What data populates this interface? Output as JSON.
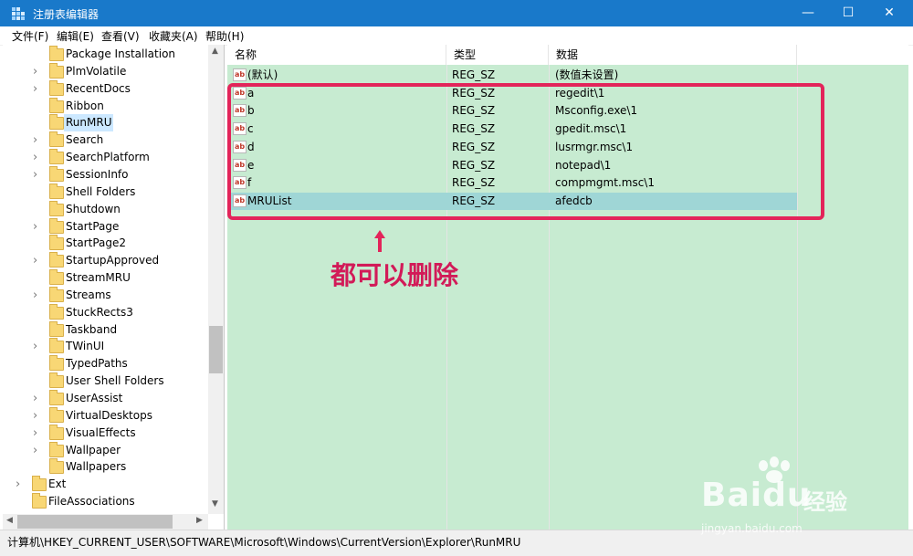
{
  "window": {
    "title": "注册表编辑器",
    "buttons": {
      "minimize": "—",
      "maximize": "☐",
      "close": "✕"
    }
  },
  "menu": [
    "文件(F)",
    "编辑(E)",
    "查看(V)",
    "收藏夹(A)",
    "帮助(H)"
  ],
  "tree": {
    "items": [
      {
        "label": "Package Installation",
        "expandable": false
      },
      {
        "label": "PlmVolatile",
        "expandable": true
      },
      {
        "label": "RecentDocs",
        "expandable": true
      },
      {
        "label": "Ribbon",
        "expandable": false
      },
      {
        "label": "RunMRU",
        "expandable": false,
        "selected": true
      },
      {
        "label": "Search",
        "expandable": true
      },
      {
        "label": "SearchPlatform",
        "expandable": true
      },
      {
        "label": "SessionInfo",
        "expandable": true
      },
      {
        "label": "Shell Folders",
        "expandable": false
      },
      {
        "label": "Shutdown",
        "expandable": false
      },
      {
        "label": "StartPage",
        "expandable": true
      },
      {
        "label": "StartPage2",
        "expandable": false
      },
      {
        "label": "StartupApproved",
        "expandable": true
      },
      {
        "label": "StreamMRU",
        "expandable": false
      },
      {
        "label": "Streams",
        "expandable": true
      },
      {
        "label": "StuckRects3",
        "expandable": false
      },
      {
        "label": "Taskband",
        "expandable": false
      },
      {
        "label": "TWinUI",
        "expandable": true
      },
      {
        "label": "TypedPaths",
        "expandable": false
      },
      {
        "label": "User Shell Folders",
        "expandable": false
      },
      {
        "label": "UserAssist",
        "expandable": true
      },
      {
        "label": "VirtualDesktops",
        "expandable": true
      },
      {
        "label": "VisualEffects",
        "expandable": true
      },
      {
        "label": "Wallpaper",
        "expandable": true
      },
      {
        "label": "Wallpapers",
        "expandable": false
      },
      {
        "label": "Ext",
        "expandable": true,
        "level": "parent"
      },
      {
        "label": "FileAssociations",
        "expandable": false,
        "level": "parent"
      }
    ]
  },
  "values": {
    "headers": [
      "名称",
      "类型",
      "数据"
    ],
    "rows": [
      {
        "name": "(默认)",
        "type": "REG_SZ",
        "data": "(数值未设置)"
      },
      {
        "name": "a",
        "type": "REG_SZ",
        "data": "regedit\\1"
      },
      {
        "name": "b",
        "type": "REG_SZ",
        "data": "Msconfig.exe\\1"
      },
      {
        "name": "c",
        "type": "REG_SZ",
        "data": "gpedit.msc\\1"
      },
      {
        "name": "d",
        "type": "REG_SZ",
        "data": "lusrmgr.msc\\1"
      },
      {
        "name": "e",
        "type": "REG_SZ",
        "data": "notepad\\1"
      },
      {
        "name": "f",
        "type": "REG_SZ",
        "data": "compmgmt.msc\\1"
      },
      {
        "name": "MRUList",
        "type": "REG_SZ",
        "data": "afedcb",
        "selected": true
      }
    ],
    "value_icon": "ab"
  },
  "annotation": {
    "text": "都可以删除",
    "color": "#e3245a"
  },
  "status": {
    "path": "计算机\\HKEY_CURRENT_USER\\SOFTWARE\\Microsoft\\Windows\\CurrentVersion\\Explorer\\RunMRU"
  },
  "watermark": {
    "brand": "Baidu",
    "cn": "经验",
    "url": "jingyan.baidu.com"
  },
  "colors": {
    "titlebar": "#1979ca",
    "values_bg": "#c7ebd1",
    "selected_row": "#9fd6d6",
    "tree_selected": "#cce8ff"
  }
}
